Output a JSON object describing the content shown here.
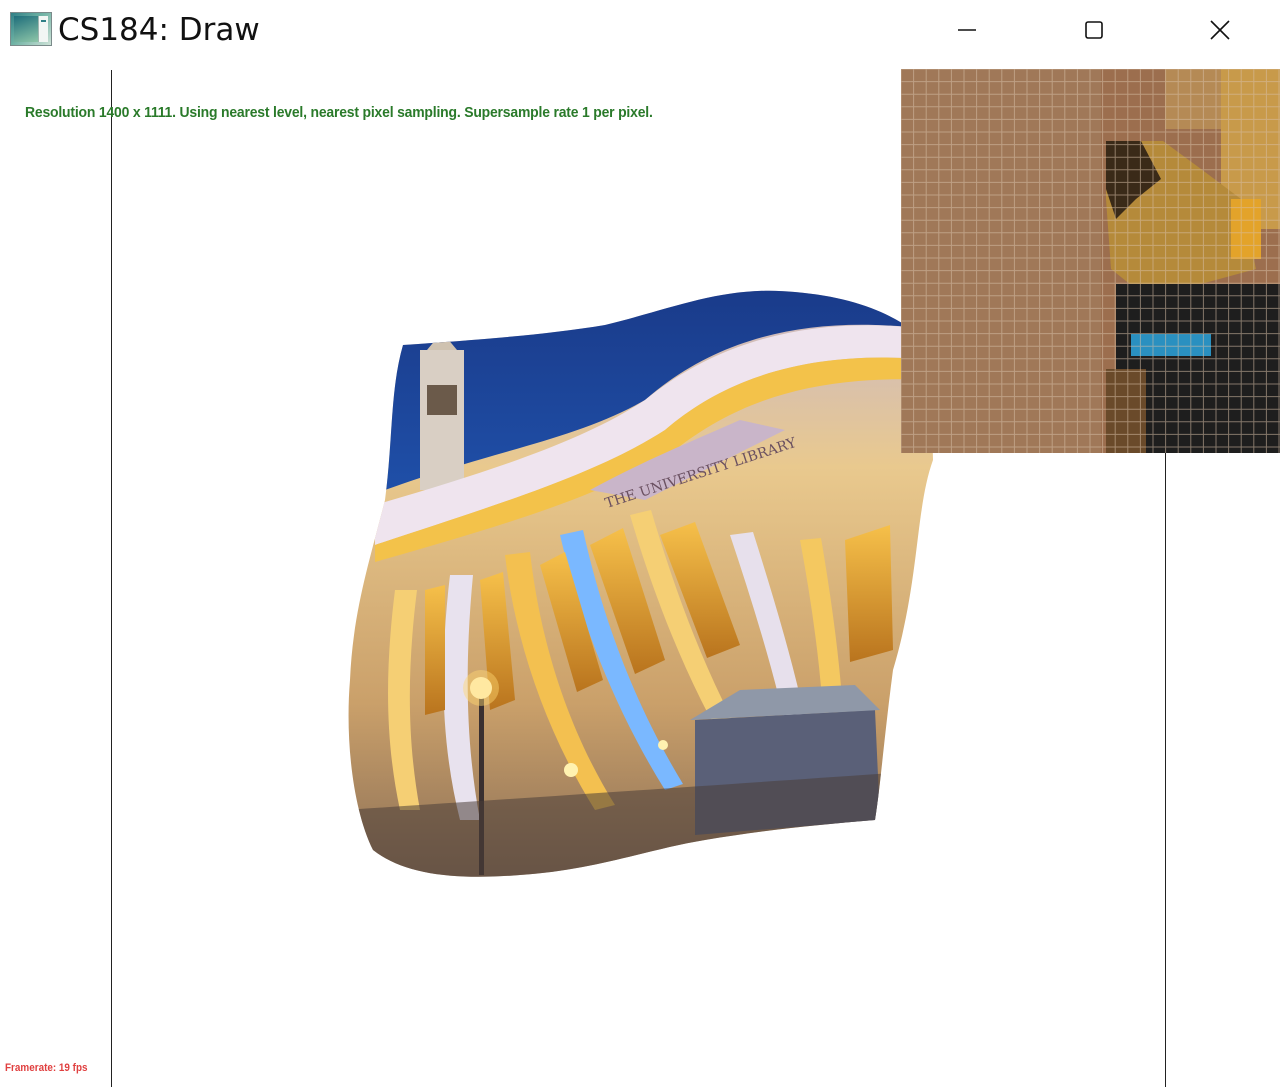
{
  "window": {
    "title": "CS184: Draw",
    "icon": "app-window-icon",
    "controls": [
      "minimize-icon",
      "maximize-icon",
      "close-icon"
    ]
  },
  "canvas": {
    "status": "Resolution 1400 x 1111. Using nearest level, nearest pixel sampling. Supersample rate 1 per pixel.",
    "framerate": "Framerate: 19 fps",
    "colors": {
      "status_text": "#2a7a2a",
      "framerate_text": "#e04040",
      "sky": "#1b3f8c",
      "facade_light": "#f2b53a",
      "column_blue": "#6fb4ff"
    },
    "image_text": "THE UNIVERSITY LIBRARY"
  }
}
